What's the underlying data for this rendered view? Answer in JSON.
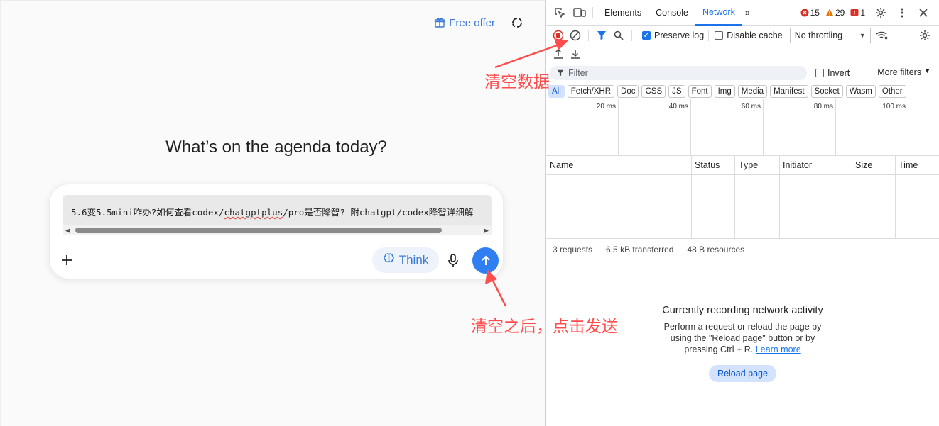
{
  "app": {
    "free_offer_label": "Free offer",
    "headline": "What’s on the agenda today?",
    "suggestion": {
      "part1": "5.6变5.5mini咋办?如何查看codex/",
      "part2": "chatgptplus",
      "part3": "/pro是否降智? 附chatgpt/codex降智详细解"
    },
    "think_label": "Think"
  },
  "annotations": {
    "clear_data": "清空数据",
    "clear_then_send": "清空之后，点击发送"
  },
  "devtools": {
    "tabs": [
      "Elements",
      "Console",
      "Network"
    ],
    "active_tab": "Network",
    "more_tabs_icon": "»",
    "badges": {
      "errors": "15",
      "warnings": "29",
      "issues": "1"
    },
    "toolbar": {
      "preserve_log": "Preserve log",
      "disable_cache": "Disable cache",
      "throttling": "No throttling"
    },
    "filter": {
      "placeholder": "Filter",
      "invert": "Invert",
      "more_filters": "More filters"
    },
    "types": [
      "All",
      "Fetch/XHR",
      "Doc",
      "CSS",
      "JS",
      "Font",
      "Img",
      "Media",
      "Manifest",
      "Socket",
      "Wasm",
      "Other"
    ],
    "timeline_ticks": [
      "20 ms",
      "40 ms",
      "60 ms",
      "80 ms",
      "100 ms"
    ],
    "columns": [
      "Name",
      "Status",
      "Type",
      "Initiator",
      "Size",
      "Time"
    ],
    "status": {
      "requests": "3 requests",
      "transferred": "6.5 kB transferred",
      "resources": "48 B resources"
    },
    "recording": {
      "title": "Currently recording network activity",
      "line1": "Perform a request or reload the page by",
      "line2": "using the \"Reload page\" button or by",
      "line3": "pressing Ctrl + R.",
      "learn_more": "Learn more",
      "reload_button": "Reload page"
    }
  },
  "colors": {
    "accent_blue": "#1a73e8",
    "send_blue": "#2f7ef2",
    "annotation_red": "#ff4d4d",
    "error_red": "#d93025",
    "warning_orange": "#e37400"
  }
}
